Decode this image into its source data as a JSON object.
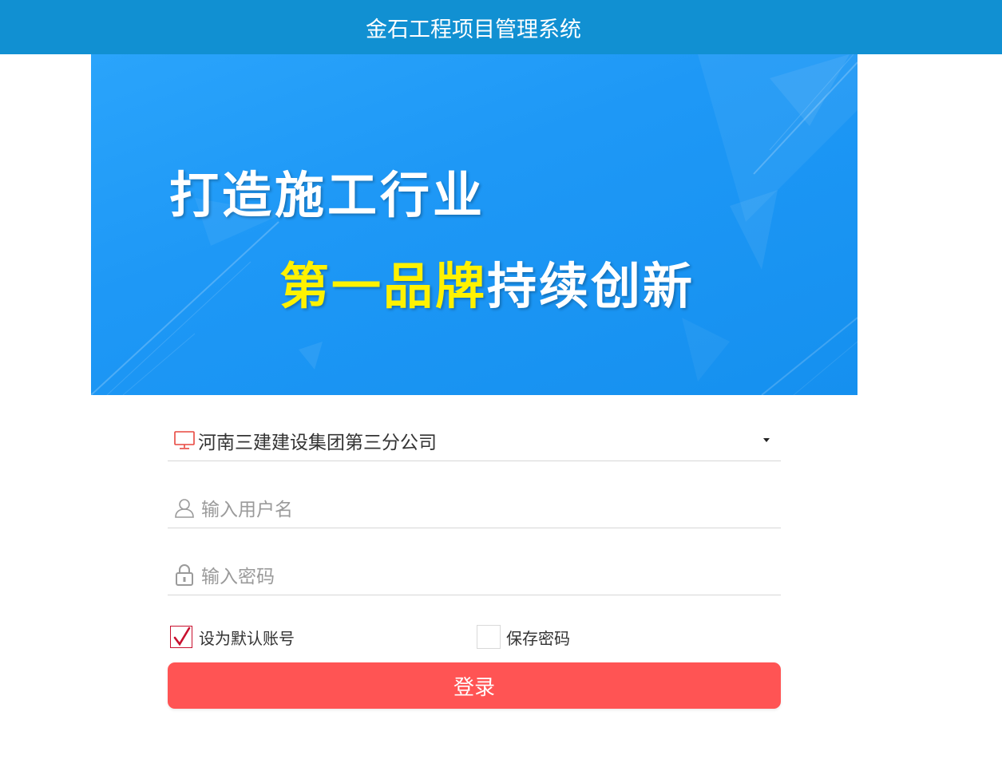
{
  "header": {
    "title": "金石工程项目管理系统",
    "background": "#1190d2"
  },
  "banner": {
    "line1": "打造施工行业",
    "line2_yellow": "第一品牌",
    "line2_white": "持续创新",
    "background": "#1e98f6",
    "highlight_color": "#fff200"
  },
  "form": {
    "company": {
      "icon": "monitor-icon",
      "value": "河南三建建设集团第三分公司"
    },
    "username": {
      "icon": "user-icon",
      "placeholder": "输入用户名",
      "value": ""
    },
    "password": {
      "icon": "lock-icon",
      "placeholder": "输入密码",
      "value": ""
    },
    "default_account": {
      "label": "设为默认账号",
      "checked": true
    },
    "save_password": {
      "label": "保存密码",
      "checked": false
    },
    "login_label": "登录",
    "login_color": "#ff5454"
  }
}
